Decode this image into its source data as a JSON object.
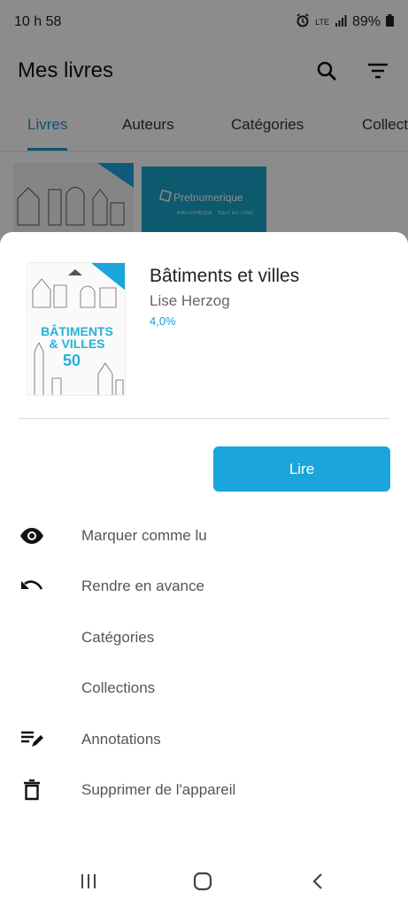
{
  "status_bar": {
    "time": "10 h 58",
    "network": "LTE",
    "battery": "89%"
  },
  "app_bar": {
    "title": "Mes livres"
  },
  "tabs": [
    {
      "label": "Livres"
    },
    {
      "label": "Auteurs"
    },
    {
      "label": "Catégories"
    },
    {
      "label": "Collections"
    }
  ],
  "grid": {
    "cover2_brand": "Pretnumerique",
    "cover2_tagline": "BIBLIOTHÈQUE · TOUT AU LONG"
  },
  "sheet": {
    "book": {
      "title": "Bâtiments et villes",
      "author": "Lise Herzog",
      "progress": "4,0%",
      "cover_title_line1": "BÂTIMENTS",
      "cover_title_line2": "& VILLES",
      "cover_number": "50"
    },
    "read_button": "Lire",
    "menu": [
      {
        "label": "Marquer comme lu",
        "icon": "eye-icon"
      },
      {
        "label": "Rendre en avance",
        "icon": "undo-icon"
      },
      {
        "label": "Catégories",
        "icon": ""
      },
      {
        "label": "Collections",
        "icon": ""
      },
      {
        "label": "Annotations",
        "icon": "edit-list-icon"
      },
      {
        "label": "Supprimer de l'appareil",
        "icon": "trash-icon"
      }
    ]
  },
  "colors": {
    "accent": "#1a9bd1",
    "button": "#1aa6dc"
  }
}
